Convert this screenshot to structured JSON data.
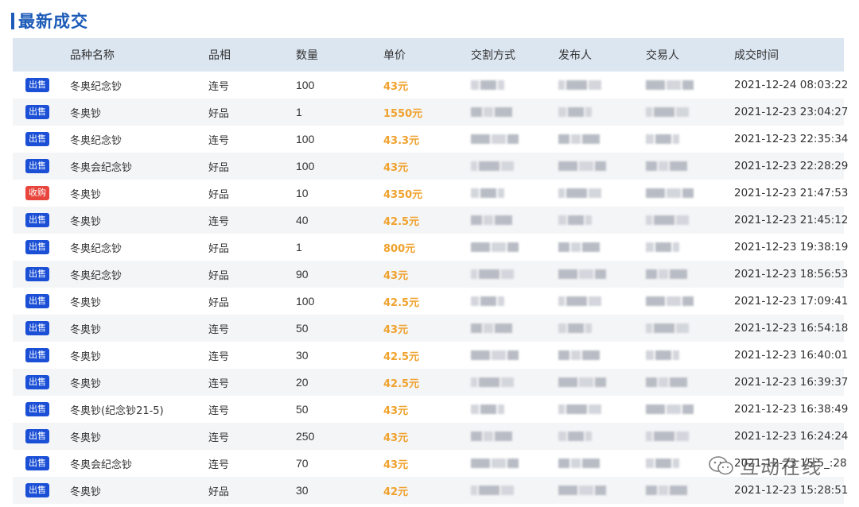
{
  "header": {
    "title": "最新成交"
  },
  "columns": [
    "",
    "品种名称",
    "品相",
    "数量",
    "单价",
    "交割方式",
    "发布人",
    "交易人",
    "成交时间"
  ],
  "rows": [
    {
      "type": "出售",
      "kind": "sell",
      "name": "冬奥纪念钞",
      "cond": "连号",
      "qty": "100",
      "price": "43元",
      "time": "2021-12-24 08:03:22"
    },
    {
      "type": "出售",
      "kind": "sell",
      "name": "冬奥钞",
      "cond": "好品",
      "qty": "1",
      "price": "1550元",
      "time": "2021-12-23 23:04:27"
    },
    {
      "type": "出售",
      "kind": "sell",
      "name": "冬奥纪念钞",
      "cond": "连号",
      "qty": "100",
      "price": "43.3元",
      "time": "2021-12-23 22:35:34"
    },
    {
      "type": "出售",
      "kind": "sell",
      "name": "冬奥会纪念钞",
      "cond": "好品",
      "qty": "100",
      "price": "43元",
      "time": "2021-12-23 22:28:29"
    },
    {
      "type": "收购",
      "kind": "buy",
      "name": "冬奥钞",
      "cond": "好品",
      "qty": "10",
      "price": "4350元",
      "time": "2021-12-23 21:47:53"
    },
    {
      "type": "出售",
      "kind": "sell",
      "name": "冬奥钞",
      "cond": "连号",
      "qty": "40",
      "price": "42.5元",
      "time": "2021-12-23 21:45:12"
    },
    {
      "type": "出售",
      "kind": "sell",
      "name": "冬奥纪念钞",
      "cond": "好品",
      "qty": "1",
      "price": "800元",
      "time": "2021-12-23 19:38:19"
    },
    {
      "type": "出售",
      "kind": "sell",
      "name": "冬奥纪念钞",
      "cond": "好品",
      "qty": "90",
      "price": "43元",
      "time": "2021-12-23 18:56:53"
    },
    {
      "type": "出售",
      "kind": "sell",
      "name": "冬奥钞",
      "cond": "好品",
      "qty": "100",
      "price": "42.5元",
      "time": "2021-12-23 17:09:41"
    },
    {
      "type": "出售",
      "kind": "sell",
      "name": "冬奥钞",
      "cond": "连号",
      "qty": "50",
      "price": "43元",
      "time": "2021-12-23 16:54:18"
    },
    {
      "type": "出售",
      "kind": "sell",
      "name": "冬奥钞",
      "cond": "连号",
      "qty": "30",
      "price": "42.5元",
      "time": "2021-12-23 16:40:01"
    },
    {
      "type": "出售",
      "kind": "sell",
      "name": "冬奥钞",
      "cond": "连号",
      "qty": "20",
      "price": "42.5元",
      "time": "2021-12-23 16:39:37"
    },
    {
      "type": "出售",
      "kind": "sell",
      "name": "冬奥钞(纪念钞21-5)",
      "cond": "连号",
      "qty": "50",
      "price": "43元",
      "time": "2021-12-23 16:38:49"
    },
    {
      "type": "出售",
      "kind": "sell",
      "name": "冬奥钞",
      "cond": "连号",
      "qty": "250",
      "price": "43元",
      "time": "2021-12-23 16:24:24"
    },
    {
      "type": "出售",
      "kind": "sell",
      "name": "冬奥会纪念钞",
      "cond": "连号",
      "qty": "70",
      "price": "43元",
      "time": "2021-12-23 15:5_:28"
    },
    {
      "type": "出售",
      "kind": "sell",
      "name": "冬奥钞",
      "cond": "好品",
      "qty": "30",
      "price": "42元",
      "time": "2021-12-23 15:28:51"
    }
  ],
  "watermark": {
    "text": "互动在线",
    "icon": "wechat-icon"
  },
  "colors": {
    "accent": "#1c5bb8",
    "sell_badge": "#1a4fd6",
    "buy_badge": "#e8453c",
    "price": "#f0a22e",
    "header_bg": "#dce6f1"
  }
}
